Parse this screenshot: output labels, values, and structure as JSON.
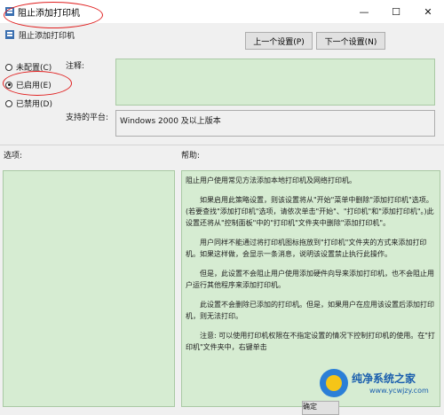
{
  "window": {
    "title": "阻止添加打印机",
    "minimize_glyph": "—",
    "maximize_glyph": "☐",
    "close_glyph": "✕"
  },
  "header": {
    "policy_name": "阻止添加打印机",
    "prev_button": "上一个设置(P)",
    "next_button": "下一个设置(N)"
  },
  "options": [
    {
      "label": "未配置(C)",
      "selected": false
    },
    {
      "label": "已启用(E)",
      "selected": true
    },
    {
      "label": "已禁用(D)",
      "selected": false
    }
  ],
  "comment": {
    "label": "注释:",
    "value": ""
  },
  "platform": {
    "label": "支持的平台:",
    "value": "Windows 2000 及以上版本"
  },
  "sections": {
    "options_label": "选项:",
    "help_label": "帮助:"
  },
  "help": {
    "p1": "阻止用户使用常见方法添加本地打印机及网络打印机。",
    "p2": "如果启用此策略设置，则该设置将从\"开始\"菜单中删除\"添加打印机\"选项。(若要查找\"添加打印机\"选项，请依次单击\"开始\"、\"打印机\"和\"添加打印机\"。)此设置还将从\"控制面板\"中的\"打印机\"文件夹中删除\"添加打印机\"。",
    "p3": "用户同样不能通过将打印机图标拖放到\"打印机\"文件夹的方式来添加打印机。如果这样做，会显示一条消息，说明该设置禁止执行此操作。",
    "p4": "但是，此设置不会阻止用户使用添加硬件向导来添加打印机，也不会阻止用户运行其他程序来添加打印机。",
    "p5": "此设置不会删除已添加的打印机。但是，如果用户在应用该设置后添加打印机，则无法打印。",
    "p6": "注意: 可以使用打印机权限在不指定设置的情况下控制打印机的使用。在\"打印机\"文件夹中，右键单击"
  },
  "footer": {
    "ok_button": "确定"
  },
  "watermark": {
    "name": "纯净系统之家",
    "url": "www.ycwjzy.com"
  },
  "colors": {
    "panel_green": "#d6ecd2",
    "highlight_red": "#e02020",
    "watermark_blue": "#1b5fae"
  }
}
